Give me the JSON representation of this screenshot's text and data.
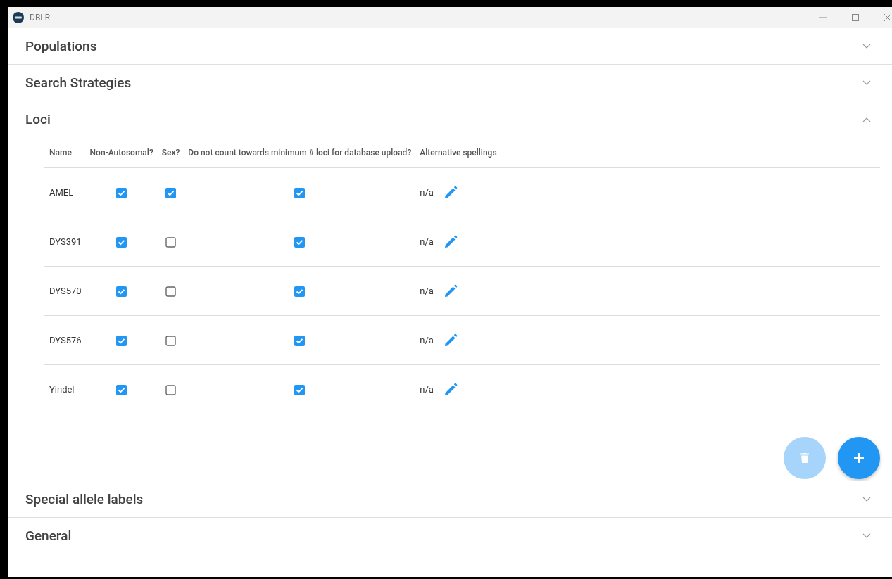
{
  "window": {
    "title": "DBLR"
  },
  "sections_before": [
    {
      "title": "Populations",
      "expanded": false
    },
    {
      "title": "Search Strategies",
      "expanded": false
    }
  ],
  "loci": {
    "title": "Loci",
    "expanded": true,
    "columns": [
      "Name",
      "Non-Autosomal?",
      "Sex?",
      "Do not count towards minimum # loci for database upload?",
      "Alternative spellings"
    ],
    "rows": [
      {
        "name": "AMEL",
        "non_autosomal": true,
        "sex": true,
        "exclude_from_minimum": true,
        "alternative_spellings": "n/a"
      },
      {
        "name": "DYS391",
        "non_autosomal": true,
        "sex": false,
        "exclude_from_minimum": true,
        "alternative_spellings": "n/a"
      },
      {
        "name": "DYS570",
        "non_autosomal": true,
        "sex": false,
        "exclude_from_minimum": true,
        "alternative_spellings": "n/a"
      },
      {
        "name": "DYS576",
        "non_autosomal": true,
        "sex": false,
        "exclude_from_minimum": true,
        "alternative_spellings": "n/a"
      },
      {
        "name": "Yindel",
        "non_autosomal": true,
        "sex": false,
        "exclude_from_minimum": true,
        "alternative_spellings": "n/a"
      }
    ],
    "delete_button": {
      "disabled": true
    },
    "add_button": {
      "disabled": false
    }
  },
  "sections_after": [
    {
      "title": "Special allele labels",
      "expanded": false
    },
    {
      "title": "General",
      "expanded": false
    }
  ]
}
